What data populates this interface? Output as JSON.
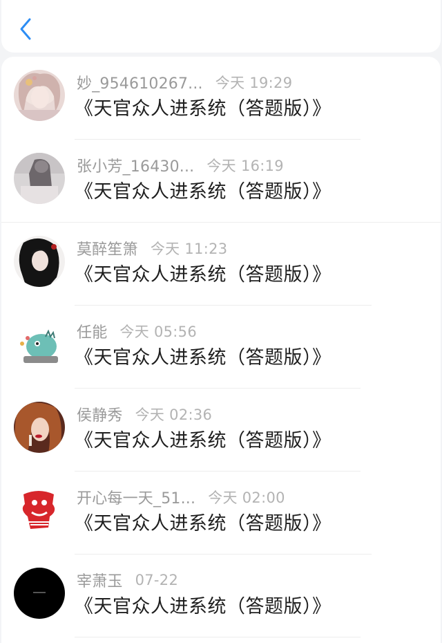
{
  "header": {
    "back_icon": "chevron-left-icon",
    "accent": "#2c8df4"
  },
  "messages": [
    {
      "name": "妙_954610267...",
      "time": "今天 19:29",
      "text": "《天官众人进系统（答题版）》",
      "avatar": "anime-girl-pink"
    },
    {
      "name": "张小芳_16430...",
      "time": "今天 16:19",
      "text": "《天官众人进系统（答题版）》",
      "avatar": "grayscale-photo"
    },
    {
      "name": "莫醉笙箫",
      "time": "今天 11:23",
      "text": "《天官众人进系统（答题版）》",
      "avatar": "anime-dark-hair"
    },
    {
      "name": "任能",
      "time": "今天 05:56",
      "text": "《天官众人进系统（答题版）》",
      "avatar": "cartoon-dinosaur"
    },
    {
      "name": "侯静秀",
      "time": "今天 02:36",
      "text": "《天官众人进系统（答题版）》",
      "avatar": "portrait-woman"
    },
    {
      "name": "开心每一天_51...",
      "time": "今天 02:00",
      "text": "《天官众人进系统（答题版）》",
      "avatar": "red-papercut"
    },
    {
      "name": "宰萧玉",
      "time": "07-22",
      "text": "《天官众人进系统（答题版）》",
      "avatar": "black-circle"
    }
  ]
}
